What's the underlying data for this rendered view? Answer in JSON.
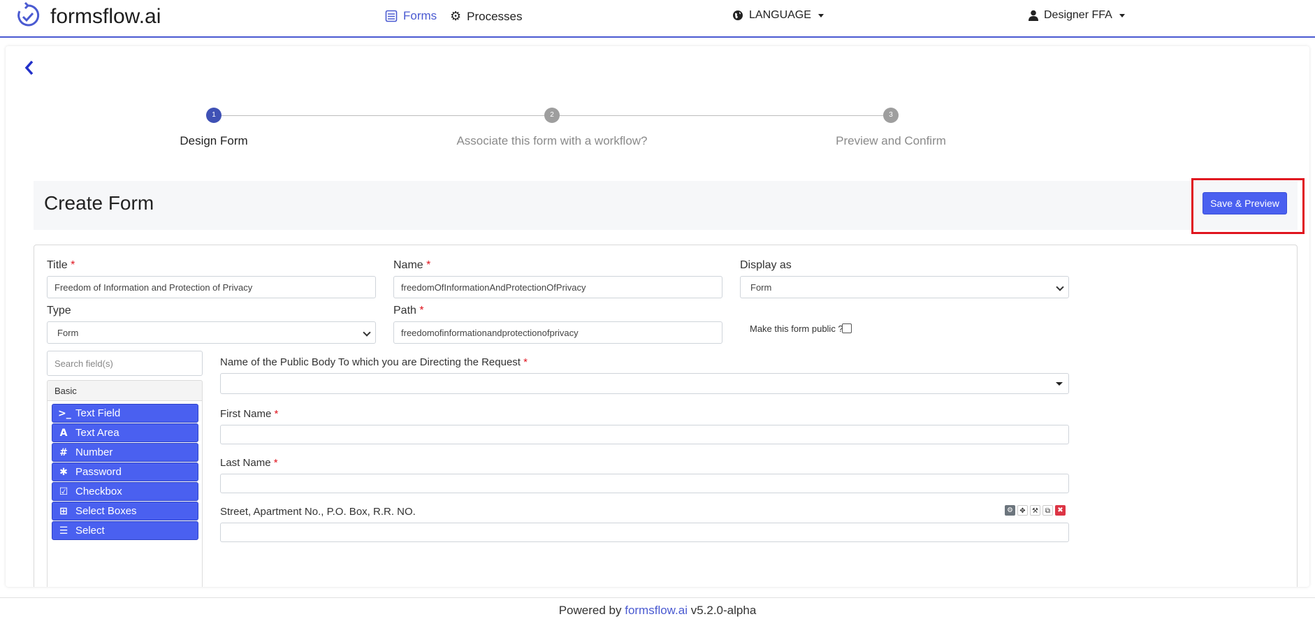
{
  "header": {
    "brand": "formsflow.ai",
    "nav": {
      "forms": "Forms",
      "processes": "Processes",
      "language": "LANGUAGE",
      "user": "Designer FFA"
    }
  },
  "stepper": [
    {
      "number": "1",
      "label": "Design Form"
    },
    {
      "number": "2",
      "label": "Associate this form with a workflow?"
    },
    {
      "number": "3",
      "label": "Preview and Confirm"
    }
  ],
  "create": {
    "title": "Create Form",
    "save_label": "Save & Preview"
  },
  "form": {
    "title_label": "Title",
    "title_value": "Freedom of Information and Protection of Privacy",
    "name_label": "Name",
    "name_value": "freedomOfInformationAndProtectionOfPrivacy",
    "display_label": "Display as",
    "display_value": "Form",
    "type_label": "Type",
    "type_value": "Form",
    "path_label": "Path",
    "path_value": "freedomofinformationandprotectionofprivacy",
    "public_label": "Make this form public ?",
    "required_mark": "*"
  },
  "builder": {
    "search_placeholder": "Search field(s)",
    "group_label": "Basic",
    "components": [
      {
        "icon": ">_",
        "label": "Text Field"
      },
      {
        "icon": "A",
        "label": "Text Area"
      },
      {
        "icon": "#",
        "label": "Number"
      },
      {
        "icon": "✱",
        "label": "Password"
      },
      {
        "icon": "☑",
        "label": "Checkbox"
      },
      {
        "icon": "⊞",
        "label": "Select Boxes"
      },
      {
        "icon": "☰",
        "label": "Select"
      }
    ],
    "fields": [
      {
        "label": "Name of the Public Body To which you are Directing the Request"
      },
      {
        "label": "First Name"
      },
      {
        "label": "Last Name"
      },
      {
        "label": "Street, Apartment No., P.O. Box, R.R. NO."
      }
    ],
    "tool_icons": [
      "gear-icon",
      "move-icon",
      "wrench-icon",
      "copy-icon",
      "remove-icon"
    ]
  },
  "footer": {
    "prefix": "Powered by",
    "link": "formsflow.ai",
    "version": "v5.2.0-alpha"
  },
  "colors": {
    "accent": "#4a60f0",
    "highlight": "#e0151f",
    "step_active": "#3f51b5",
    "step_inactive": "#9e9e9e"
  }
}
